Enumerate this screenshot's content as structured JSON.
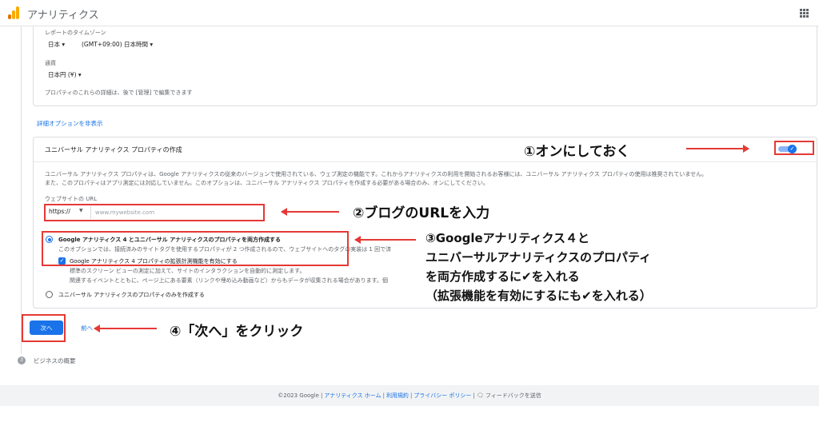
{
  "app": {
    "title": "アナリティクス"
  },
  "property_details": {
    "timezone_label": "レポートのタイムゾーン",
    "country": "日本",
    "timezone": "(GMT+09:00) 日本時間",
    "currency_label": "通貨",
    "currency": "日本円 (¥)",
    "note": "プロパティのこれらの詳細は、後で [管理] で編集できます"
  },
  "advanced_link": "詳細オプションを非表示",
  "ua_section": {
    "title": "ユニバーサル アナリティクス プロパティの作成",
    "description_line1": "ユニバーサル アナリティクス プロパティは、Google アナリティクスの従来のバージョンで使用されている、ウェブ測定の機能です。これからアナリティクスの利用を開始されるお客様には、ユニバーサル アナリティクス プロパティの使用は推奨されていません。",
    "description_line2": "また、このプロパティはアプリ測定には対応していません。このオプションは、ユニバーサル アナリティクス プロパティを作成する必要がある場合のみ、オンにしてください。",
    "url_label": "ウェブサイトの URL",
    "protocol": "https://",
    "url_placeholder": "www.mywebsite.com",
    "option_both_title": "Google アナリティクス 4 とユニバーサル アナリティクスのプロパティを両方作成する",
    "option_both_text": "このオプションでは、接続済みのサイトタグを使用するプロパティが 2 つ作成されるので、ウェブサイトへのタグの実装は 1 回で済",
    "enhanced_label": "Google アナリティクス 4 プロパティの拡張計測機能を有効にする",
    "enhanced_text1": "標準のスクリーン ビューの測定に加えて、サイトのインタラクションを自動的に測定します。",
    "enhanced_text2": "関連するイベントとともに、ページ上にある要素（リンクや埋め込み動画など）からもデータが収集される場合があります。個",
    "option_ua_only": "ユニバーサル アナリティクスのプロパティのみを作成する"
  },
  "buttons": {
    "next": "次へ",
    "prev": "前へ"
  },
  "step3": {
    "number": "3",
    "label": "ビジネスの概要"
  },
  "footer": {
    "copyright": "©2023 Google",
    "home": "アナリティクス ホーム",
    "terms": "利用規約",
    "privacy": "プライバシー ポリシー",
    "feedback": "フィードバックを送信"
  },
  "annotations": {
    "a1": "①オンにしておく",
    "a2": "②ブログのURLを入力",
    "a3_line1": "③Googleアナリティクス４と",
    "a3_line2": "ユニバーサルアナリティクスのプロパティ",
    "a3_line3": "を両方作成するに✔を入れる",
    "a3_line4": "（拡張機能を有効にするにも✔を入れる）",
    "a4": "④「次へ」をクリック"
  },
  "colors": {
    "accent": "#1a73e8",
    "annotation": "#e53935"
  }
}
